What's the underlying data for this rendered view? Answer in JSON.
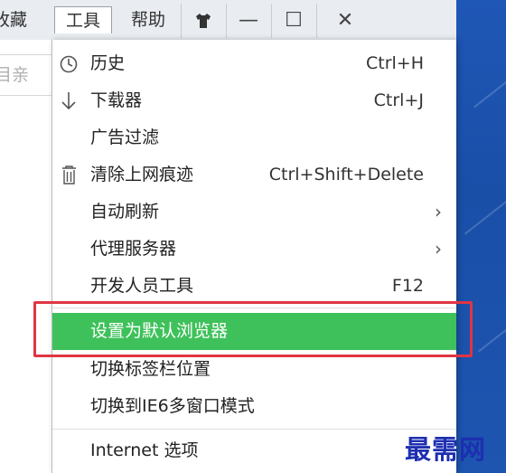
{
  "menubar": {
    "favorites_partial": "收藏",
    "tools": "工具",
    "help": "帮助"
  },
  "window_controls": {
    "skin": "skin-icon",
    "minimize": "—",
    "maximize": "☐",
    "close": "✕"
  },
  "address_partial": "目亲",
  "menu": {
    "items": [
      {
        "label": "历史",
        "shortcut": "Ctrl+H",
        "icon": "clock-icon"
      },
      {
        "label": "下载器",
        "shortcut": "Ctrl+J",
        "icon": "download-arrow-icon"
      },
      {
        "label": "广告过滤",
        "shortcut": "",
        "icon": ""
      },
      {
        "label": "清除上网痕迹",
        "shortcut": "Ctrl+Shift+Delete",
        "icon": "trash-icon"
      },
      {
        "label": "自动刷新",
        "shortcut": "",
        "submenu": "›"
      },
      {
        "label": "代理服务器",
        "shortcut": "",
        "submenu": "›"
      },
      {
        "label": "开发人员工具",
        "shortcut": "F12"
      },
      {
        "label": "设置为默认浏览器",
        "shortcut": "",
        "highlighted": true
      },
      {
        "label": "切换标签栏位置",
        "shortcut": ""
      },
      {
        "label": "切换到IE6多窗口模式",
        "shortcut": ""
      },
      {
        "label": "Internet 选项",
        "shortcut": ""
      }
    ]
  },
  "highlight_color": "#3ec15a",
  "annotation_color": "#e03542",
  "watermark": "最需网"
}
